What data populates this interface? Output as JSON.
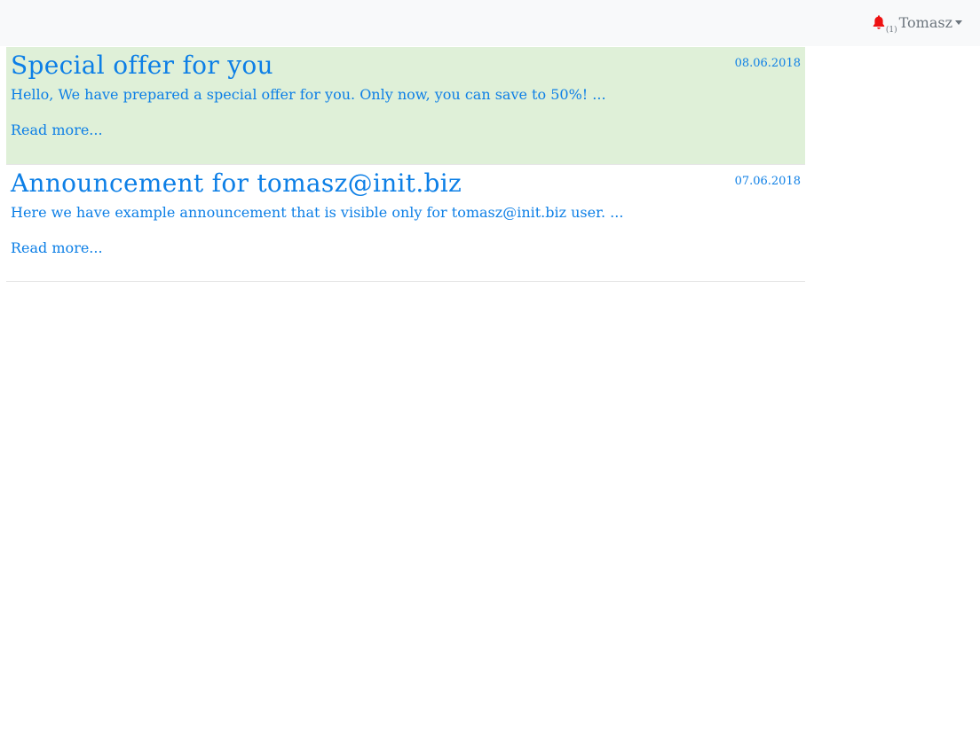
{
  "navbar": {
    "notifications": {
      "icon": "bell-icon",
      "count_label": "(1)",
      "icon_color": "#ee1111"
    },
    "user": {
      "name": "Tomasz",
      "caret_icon": "caret-down-icon"
    }
  },
  "announcements": [
    {
      "title": "Special offer for you",
      "date": "08.06.2018",
      "excerpt": "Hello, We have prepared a special offer for you. Only now, you can save to 50%! ...",
      "read_more": "Read more...",
      "state": "unread",
      "background": "#dff0d8"
    },
    {
      "title": "Announcement for tomasz@init.biz",
      "date": "07.06.2018",
      "excerpt": "Here we have example announcement that is visible only for tomasz@init.biz user. ...",
      "read_more": "Read more...",
      "state": "read",
      "background": "#ffffff"
    }
  ],
  "colors": {
    "link": "#0d7fe6",
    "navbar_bg": "#f8f9fa",
    "muted": "#6c757d"
  }
}
